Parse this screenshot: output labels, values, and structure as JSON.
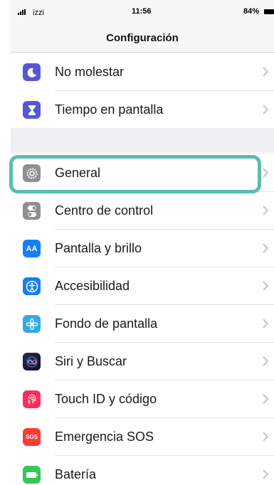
{
  "status_bar": {
    "carrier": "izzi",
    "time": "11:56",
    "battery": "84%"
  },
  "nav": {
    "title": "Configuración"
  },
  "group_top": [
    {
      "label": "No molestar",
      "icon": "moon-icon",
      "color": "#5856d6"
    },
    {
      "label": "Tiempo en pantalla",
      "icon": "hourglass-icon",
      "color": "#5856d6"
    }
  ],
  "group_main": [
    {
      "label": "General",
      "icon": "gear-icon",
      "color": "#8e8e93"
    },
    {
      "label": "Centro de control",
      "icon": "toggles-icon",
      "color": "#8e8e93"
    },
    {
      "label": "Pantalla y brillo",
      "icon": "text-size-icon",
      "color": "#147efb",
      "glyph": "AA"
    },
    {
      "label": "Accesibilidad",
      "icon": "accessibility-icon",
      "color": "#147efb"
    },
    {
      "label": "Fondo de pantalla",
      "icon": "flower-icon",
      "color": "#35aadc"
    },
    {
      "label": "Siri y Buscar",
      "icon": "siri-icon",
      "color": "#1c1c3a"
    },
    {
      "label": "Touch ID y código",
      "icon": "fingerprint-icon",
      "color": "#ff2d55"
    },
    {
      "label": "Emergencia SOS",
      "icon": "sos-icon",
      "color": "#ff3b30",
      "glyph": "SOS"
    },
    {
      "label": "Batería",
      "icon": "battery-icon",
      "color": "#34c759"
    }
  ],
  "highlight_color": "#5bbcb5"
}
